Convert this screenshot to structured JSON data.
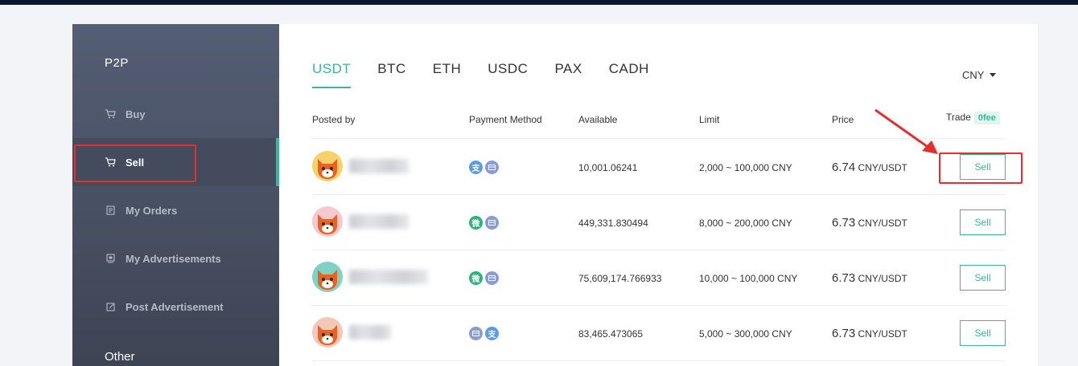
{
  "sidebar": {
    "title": "P2P",
    "items": [
      {
        "label": "Buy",
        "icon": "cart-icon"
      },
      {
        "label": "Sell",
        "icon": "cart-icon"
      },
      {
        "label": "My Orders",
        "icon": "document-icon"
      },
      {
        "label": "My Advertisements",
        "icon": "monitor-icon"
      },
      {
        "label": "Post Advertisement",
        "icon": "edit-icon"
      }
    ],
    "other": "Other"
  },
  "tabs": [
    "USDT",
    "BTC",
    "ETH",
    "USDC",
    "PAX",
    "CADH"
  ],
  "active_tab": "USDT",
  "currency": "CNY",
  "table": {
    "headers": {
      "posted_by": "Posted by",
      "payment": "Payment Method",
      "available": "Available",
      "limit": "Limit",
      "price": "Price",
      "trade": "Trade",
      "fee_badge": "0fee"
    },
    "rows": [
      {
        "available": "10,001.06241",
        "limit": "2,000 ~ 100,000 CNY",
        "price": "6.74",
        "unit": "CNY/USDT",
        "action": "Sell",
        "payments": [
          "alipay",
          "bank"
        ]
      },
      {
        "available": "449,331.830494",
        "limit": "8,000 ~ 200,000 CNY",
        "price": "6.73",
        "unit": "CNY/USDT",
        "action": "Sell",
        "payments": [
          "wechat",
          "bank"
        ]
      },
      {
        "available": "75,609,174.766933",
        "limit": "10,000 ~ 100,000 CNY",
        "price": "6.73",
        "unit": "CNY/USDT",
        "action": "Sell",
        "payments": [
          "wechat",
          "bank"
        ]
      },
      {
        "available": "83,465.473065",
        "limit": "5,000 ~ 300,000 CNY",
        "price": "6.73",
        "unit": "CNY/USDT",
        "action": "Sell",
        "payments": [
          "bank",
          "alipay"
        ]
      }
    ]
  },
  "payment_glyphs": {
    "alipay": "支",
    "wechat": "微",
    "bank": ""
  },
  "colors": {
    "accent": "#3bb795",
    "highlight": "#e62e2e",
    "sidebar": "#4a5366",
    "alipay": "#5b9ce8",
    "wechat": "#2ab37c",
    "bank": "#8a9cd6"
  }
}
